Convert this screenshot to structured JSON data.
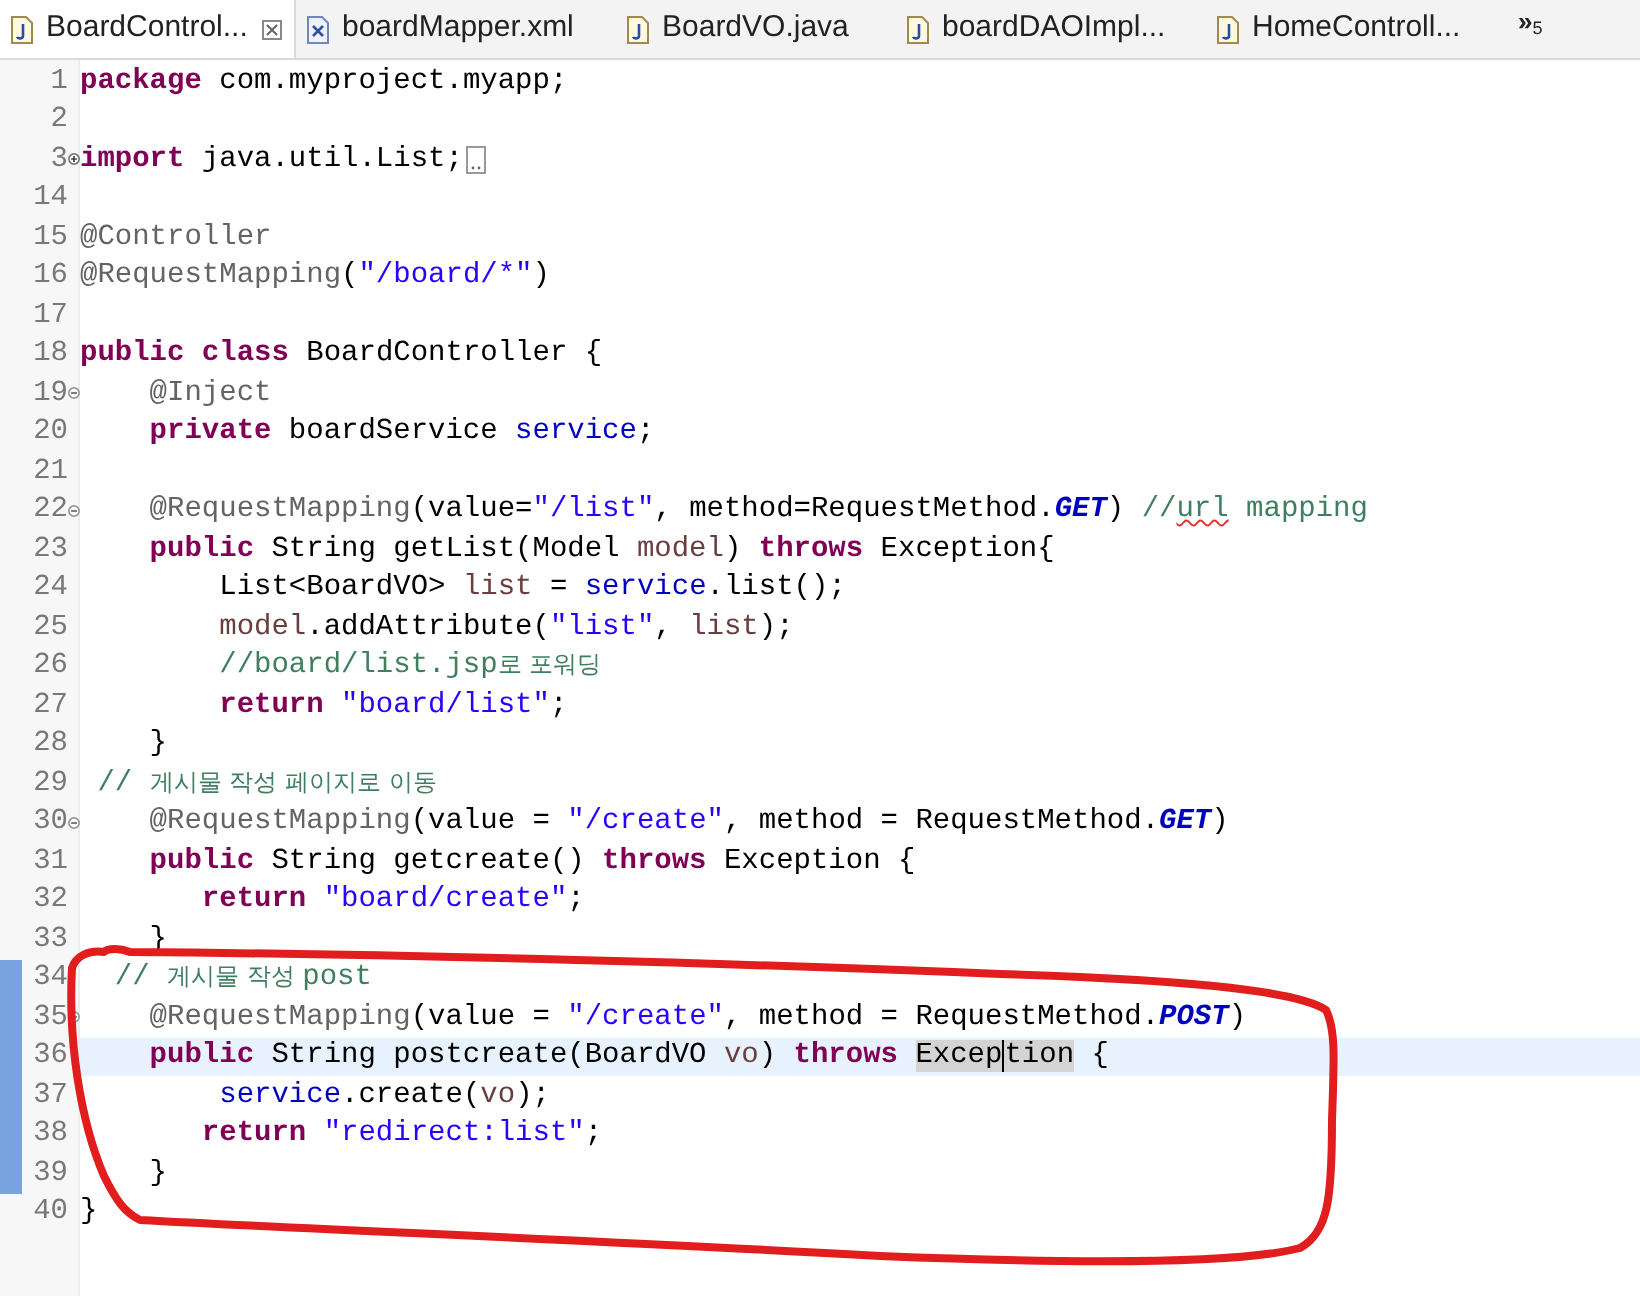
{
  "tabs": [
    {
      "label": "BoardControl...",
      "kind": "java",
      "selected": true
    },
    {
      "label": "boardMapper.xml",
      "kind": "xml",
      "selected": false
    },
    {
      "label": "BoardVO.java",
      "kind": "java",
      "selected": false
    },
    {
      "label": "boardDAOImpl...",
      "kind": "java",
      "selected": false
    },
    {
      "label": "HomeControll...",
      "kind": "java",
      "selected": false
    }
  ],
  "overflow": {
    "label": "»",
    "count": "5"
  },
  "lines": [
    {
      "number": "1",
      "tokens": [
        {
          "kind": "keyword",
          "text": "package"
        },
        {
          "kind": "plain",
          "text": " com.myproject.myapp;"
        }
      ]
    },
    {
      "number": "2"
    },
    {
      "number": "3",
      "collapsed": true,
      "tokens": [
        {
          "kind": "keyword",
          "text": "import"
        },
        {
          "kind": "plain",
          "text": " java.util.List;"
        }
      ]
    },
    {
      "number": "14"
    },
    {
      "number": "15",
      "tokens": [
        {
          "kind": "annotation",
          "text": "@Controller"
        }
      ]
    },
    {
      "number": "16",
      "tokens": [
        {
          "kind": "annotation",
          "text": "@RequestMapping"
        },
        {
          "kind": "plain",
          "text": "("
        },
        {
          "kind": "string",
          "text": "\"/board/*\""
        },
        {
          "kind": "plain",
          "text": ")"
        }
      ]
    },
    {
      "number": "17"
    },
    {
      "number": "18",
      "tokens": [
        {
          "kind": "keyword",
          "text": "public"
        },
        {
          "kind": "keyword",
          "text": " class"
        },
        {
          "kind": "plain",
          "text": " BoardController {"
        }
      ]
    },
    {
      "number": "19",
      "collapsed": false,
      "tokens": [
        {
          "kind": "annotation",
          "text": "    @Inject"
        }
      ]
    },
    {
      "number": "20",
      "tokens": [
        {
          "kind": "keyword",
          "text": "    private"
        },
        {
          "kind": "plain",
          "text": " boardService "
        },
        {
          "kind": "field",
          "text": "service"
        },
        {
          "kind": "plain",
          "text": ";"
        }
      ]
    },
    {
      "number": "21"
    },
    {
      "number": "22",
      "collapsed": false,
      "tokens": [
        {
          "kind": "annotation",
          "text": "    @RequestMapping"
        },
        {
          "kind": "plain",
          "text": "(value="
        },
        {
          "kind": "string",
          "text": "\"/list\""
        },
        {
          "kind": "plain",
          "text": ", method=RequestMethod."
        },
        {
          "kind": "constant",
          "text": "GET"
        },
        {
          "kind": "plain",
          "text": ")"
        },
        {
          "kind": "comment",
          "text": " //"
        },
        {
          "kind": "comment",
          "text": "url",
          "misspelled": true
        },
        {
          "kind": "comment",
          "text": " mapping"
        }
      ]
    },
    {
      "number": "23",
      "tokens": [
        {
          "kind": "keyword",
          "text": "    public"
        },
        {
          "kind": "plain",
          "text": " String getList(Model "
        },
        {
          "kind": "local",
          "text": "model"
        },
        {
          "kind": "plain",
          "text": ")"
        },
        {
          "kind": "keyword",
          "text": " throws"
        },
        {
          "kind": "plain",
          "text": " Exception{"
        }
      ]
    },
    {
      "number": "24",
      "tokens": [
        {
          "kind": "plain",
          "text": "        List<BoardVO> "
        },
        {
          "kind": "local",
          "text": "list"
        },
        {
          "kind": "plain",
          "text": " = "
        },
        {
          "kind": "field",
          "text": "service"
        },
        {
          "kind": "plain",
          "text": ".list();"
        }
      ]
    },
    {
      "number": "25",
      "tokens": [
        {
          "kind": "local",
          "text": "        model"
        },
        {
          "kind": "plain",
          "text": ".addAttribute("
        },
        {
          "kind": "string",
          "text": "\"list\""
        },
        {
          "kind": "plain",
          "text": ", "
        },
        {
          "kind": "local",
          "text": "list"
        },
        {
          "kind": "plain",
          "text": ");"
        }
      ]
    },
    {
      "number": "26",
      "tokens": [
        {
          "kind": "comment",
          "text": "        //board/list.jsp"
        },
        {
          "kind": "comment_hangul",
          "text": "로 포워딩"
        }
      ]
    },
    {
      "number": "27",
      "tokens": [
        {
          "kind": "keyword",
          "text": "        return"
        },
        {
          "kind": "string",
          "text": " \"board/list\""
        },
        {
          "kind": "plain",
          "text": ";"
        }
      ]
    },
    {
      "number": "28",
      "tokens": [
        {
          "kind": "plain",
          "text": "    }"
        }
      ]
    },
    {
      "number": "29",
      "tokens": [
        {
          "kind": "comment",
          "text": " // "
        },
        {
          "kind": "comment_hangul",
          "text": "게시물 작성 페이지로 이동"
        }
      ]
    },
    {
      "number": "30",
      "collapsed": false,
      "tokens": [
        {
          "kind": "annotation",
          "text": "    @RequestMapping"
        },
        {
          "kind": "plain",
          "text": "(value = "
        },
        {
          "kind": "string",
          "text": "\"/create\""
        },
        {
          "kind": "plain",
          "text": ", method = RequestMethod."
        },
        {
          "kind": "constant",
          "text": "GET"
        },
        {
          "kind": "plain",
          "text": ")"
        }
      ]
    },
    {
      "number": "31",
      "tokens": [
        {
          "kind": "keyword",
          "text": "    public"
        },
        {
          "kind": "plain",
          "text": " String getcreate()"
        },
        {
          "kind": "keyword",
          "text": " throws"
        },
        {
          "kind": "plain",
          "text": " Exception {"
        }
      ]
    },
    {
      "number": "32",
      "tokens": [
        {
          "kind": "keyword",
          "text": "       return"
        },
        {
          "kind": "string",
          "text": " \"board/create\""
        },
        {
          "kind": "plain",
          "text": ";"
        }
      ]
    },
    {
      "number": "33",
      "tokens": [
        {
          "kind": "plain",
          "text": "    }"
        }
      ]
    },
    {
      "number": "34",
      "changed": true,
      "tokens": [
        {
          "kind": "comment",
          "text": "  // "
        },
        {
          "kind": "comment_hangul",
          "text": "게시물 작성 "
        },
        {
          "kind": "comment",
          "text": "post"
        }
      ]
    },
    {
      "number": "35",
      "collapsed": false,
      "changed": true,
      "tokens": [
        {
          "kind": "annotation",
          "text": "    @RequestMapping"
        },
        {
          "kind": "plain",
          "text": "(value = "
        },
        {
          "kind": "string",
          "text": "\"/create\""
        },
        {
          "kind": "plain",
          "text": ", method = RequestMethod."
        },
        {
          "kind": "constant",
          "text": "POST"
        },
        {
          "kind": "plain",
          "text": ")"
        }
      ]
    },
    {
      "number": "36",
      "current": true,
      "changed": true,
      "tokens": [
        {
          "kind": "keyword",
          "text": "    public"
        },
        {
          "kind": "plain",
          "text": " String postcreate(BoardVO "
        },
        {
          "kind": "local",
          "text": "vo"
        },
        {
          "kind": "plain",
          "text": ")"
        },
        {
          "kind": "keyword",
          "text": " throws "
        },
        {
          "kind": "plain",
          "text": "Excep",
          "highlighted": true
        },
        {
          "kind": "plain",
          "text": "tion",
          "highlighted": true,
          "caret": true
        },
        {
          "kind": "plain",
          "text": " {"
        }
      ]
    },
    {
      "number": "37",
      "changed": true,
      "tokens": [
        {
          "kind": "field",
          "text": "        service"
        },
        {
          "kind": "plain",
          "text": ".create("
        },
        {
          "kind": "local",
          "text": "vo"
        },
        {
          "kind": "plain",
          "text": ");"
        }
      ]
    },
    {
      "number": "38",
      "changed": true,
      "tokens": [
        {
          "kind": "keyword",
          "text": "       return"
        },
        {
          "kind": "string",
          "text": " \"redirect:list\""
        },
        {
          "kind": "plain",
          "text": ";"
        }
      ]
    },
    {
      "number": "39",
      "changed": true,
      "tokens": [
        {
          "kind": "plain",
          "text": "    }"
        }
      ]
    },
    {
      "number": "40",
      "tokens": [
        {
          "kind": "plain",
          "text": "}"
        }
      ]
    }
  ]
}
